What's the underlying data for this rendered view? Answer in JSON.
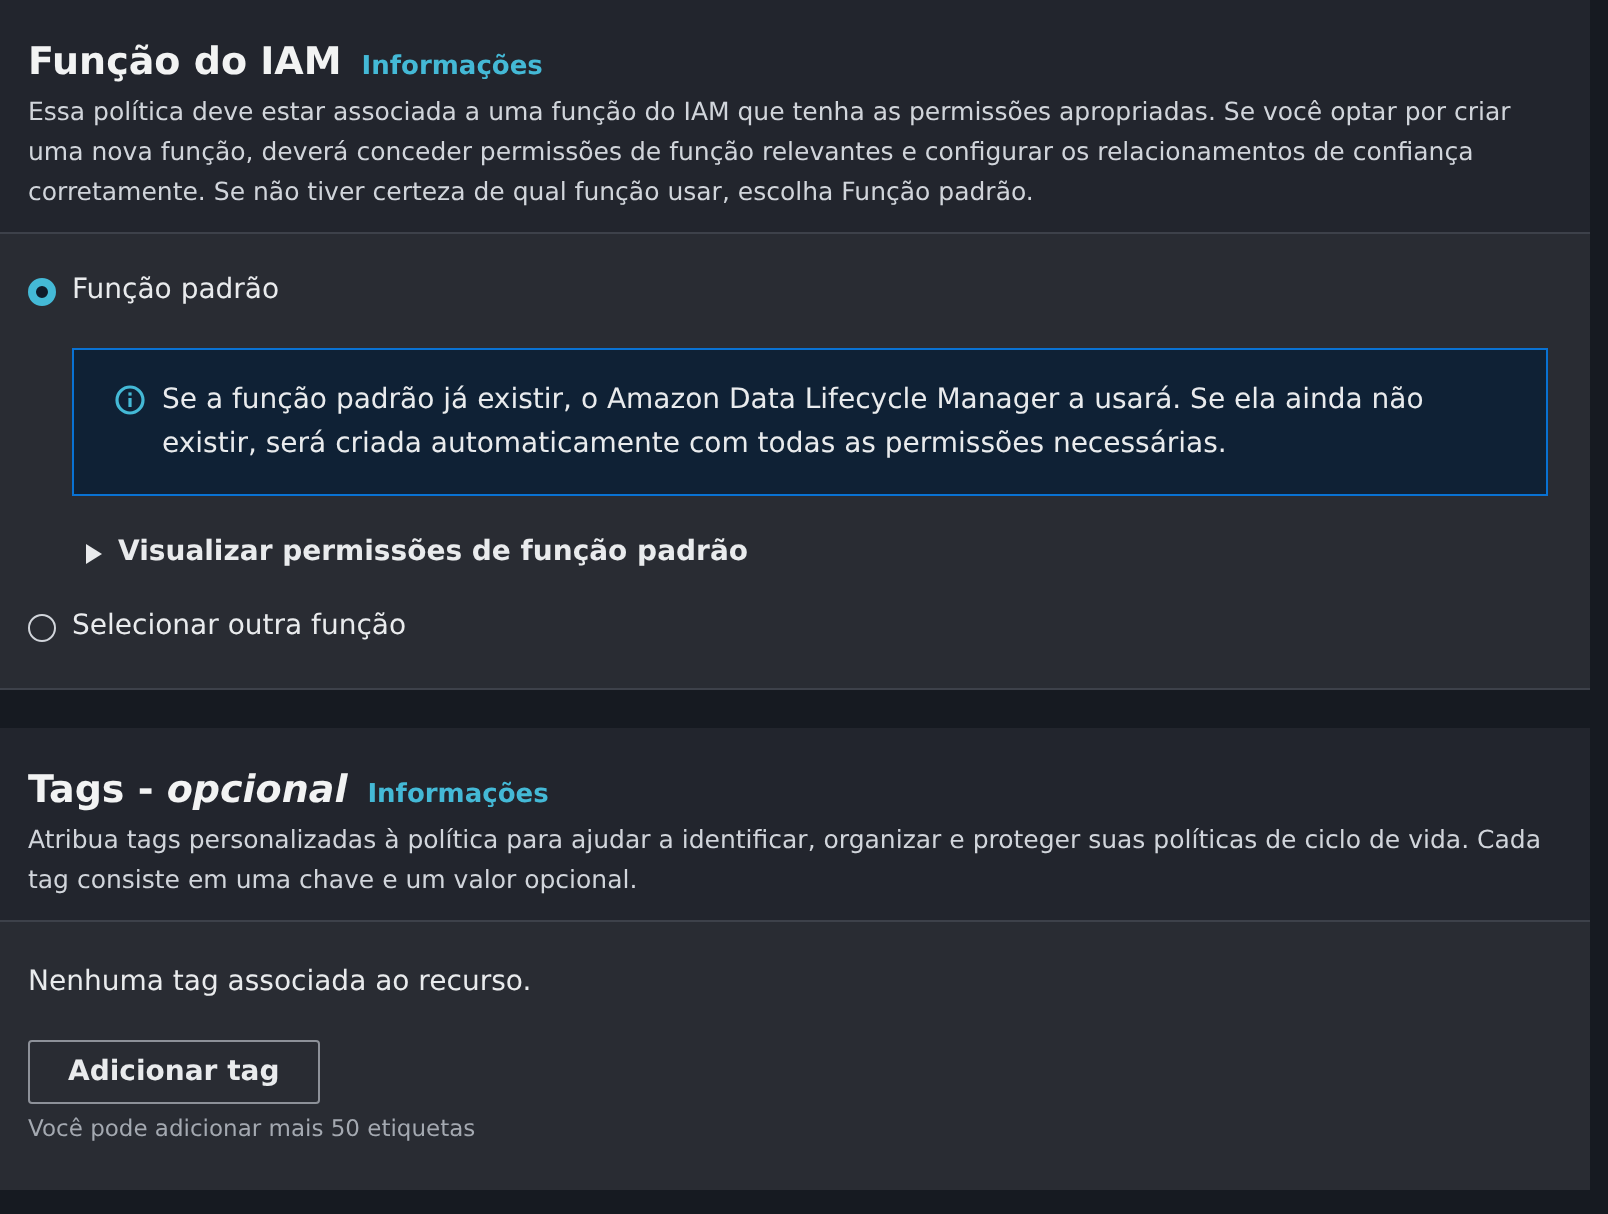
{
  "iam_role": {
    "title": "Função do IAM",
    "info_link": "Informações",
    "description": "Essa política deve estar associada a uma função do IAM que tenha as permissões apropriadas. Se você optar por criar uma nova função, deverá conceder permissões de função relevantes e configurar os relacionamentos de confiança corretamente. Se não tiver certeza de qual função usar, escolha Função padrão.",
    "options": [
      {
        "label": "Função padrão",
        "selected": true,
        "alert": "Se a função padrão já existir, o Amazon Data Lifecycle Manager a usará. Se ela ainda não existir, será criada automaticamente com todas as permissões necessárias.",
        "expander": {
          "label": "Visualizar permissões de função padrão",
          "expanded": false
        }
      },
      {
        "label": "Selecionar outra função",
        "selected": false
      }
    ]
  },
  "tags": {
    "title": "Tags - *opcional*",
    "info_link": "Informações",
    "description": "Atribua tags personalizadas à política para ajudar a identificar, organizar e proteger suas políticas de ciclo de vida. Cada tag consiste em uma chave e um valor opcional.",
    "empty_message": "Nenhuma tag associada ao recurso.",
    "button": "Adicionar tag",
    "hint": "Você pode adicionar mais 50 etiquetas"
  }
}
